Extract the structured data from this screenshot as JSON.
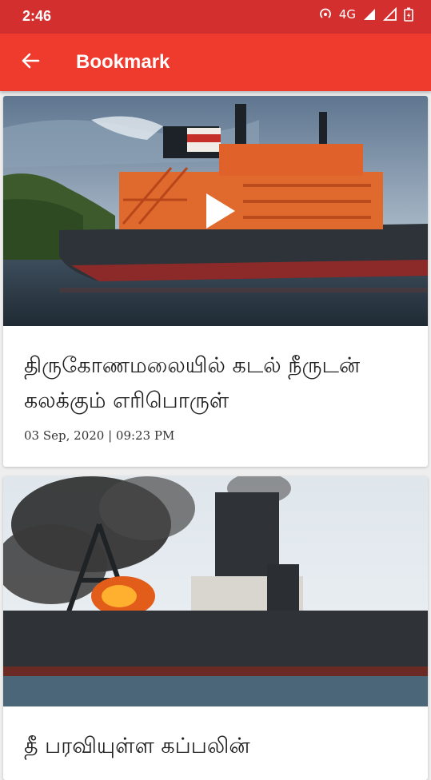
{
  "status_bar": {
    "time": "2:46",
    "network": "4G",
    "icons": [
      "hotspot-icon",
      "signal-icon",
      "signal-icon",
      "battery-icon"
    ]
  },
  "app_bar": {
    "title": "Bookmark",
    "back_icon": "arrow-left-icon"
  },
  "articles": [
    {
      "title": "திருகோணமலையில் கடல் நீருடன் கலக்கும் எரிபொருள்",
      "date": "03 Sep, 2020 | 09:23 PM",
      "has_video": true
    },
    {
      "title": "தீ பரவியுள்ள கப்பலின்",
      "has_video": false
    }
  ],
  "colors": {
    "status_bar": "#d32f2f",
    "app_bar": "#ef3a2e",
    "background": "#eeeeee"
  }
}
